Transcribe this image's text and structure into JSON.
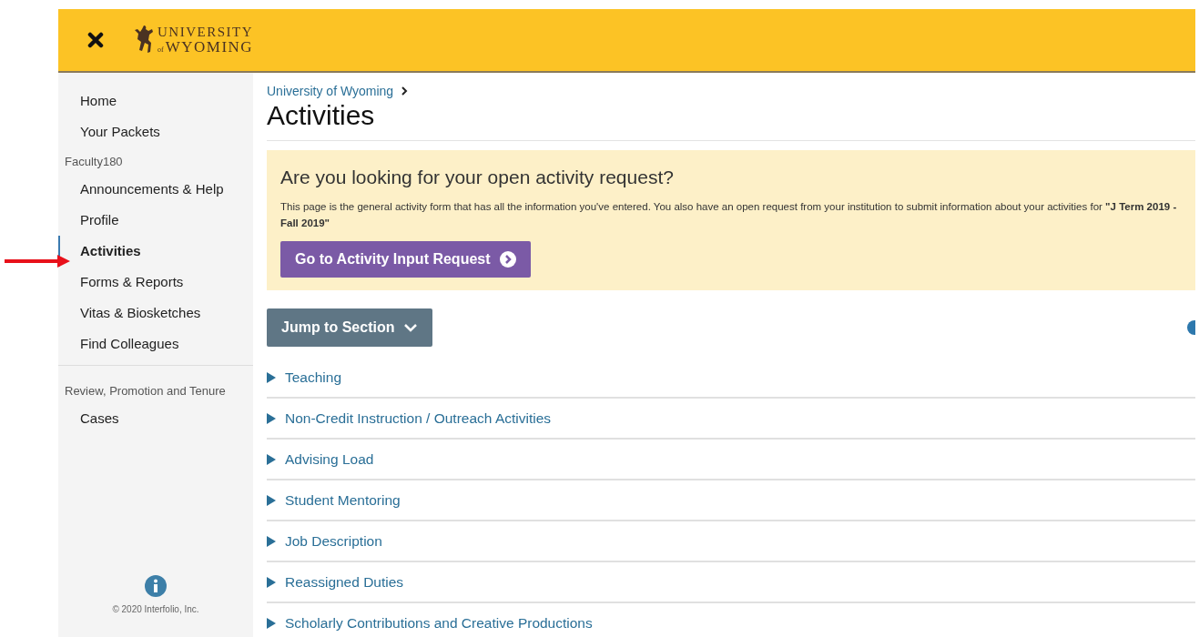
{
  "header": {
    "logo_lines": [
      "UNIVERSITY",
      "of",
      "WYOMING"
    ]
  },
  "sidebar": {
    "groups": [
      {
        "items": [
          {
            "label": "Home",
            "selected": false
          },
          {
            "label": "Your Packets",
            "selected": false
          }
        ]
      },
      {
        "heading": "Faculty180",
        "items": [
          {
            "label": "Announcements & Help",
            "selected": false
          },
          {
            "label": "Profile",
            "selected": false
          },
          {
            "label": "Activities",
            "selected": true
          },
          {
            "label": "Forms & Reports",
            "selected": false
          },
          {
            "label": "Vitas & Biosketches",
            "selected": false
          },
          {
            "label": "Find Colleagues",
            "selected": false
          }
        ]
      },
      {
        "heading": "Review, Promotion and Tenure",
        "items": [
          {
            "label": "Cases",
            "selected": false
          }
        ]
      }
    ],
    "footer": "© 2020 Interfolio, Inc."
  },
  "breadcrumb": "University of Wyoming",
  "title": "Activities",
  "notice": {
    "heading": "Are you looking for your open activity request?",
    "text": "This page is the general activity form that has all the information you've entered. You also have an open request from your institution to submit information about your activities for **\"J Term 2019 - Fall 2019\"**",
    "button": "Go to Activity Input Request"
  },
  "jump_button": "Jump to Section",
  "sections": [
    {
      "label": "Teaching",
      "expanded": false
    },
    {
      "label": "Non-Credit Instruction / Outreach Activities",
      "expanded": false
    },
    {
      "label": "Advising Load",
      "expanded": false
    },
    {
      "label": "Student Mentoring",
      "expanded": false
    },
    {
      "label": "Job Description",
      "expanded": false
    },
    {
      "label": "Reassigned Duties",
      "expanded": false
    },
    {
      "label": "Scholarly Contributions and Creative Productions",
      "expanded": false
    }
  ]
}
